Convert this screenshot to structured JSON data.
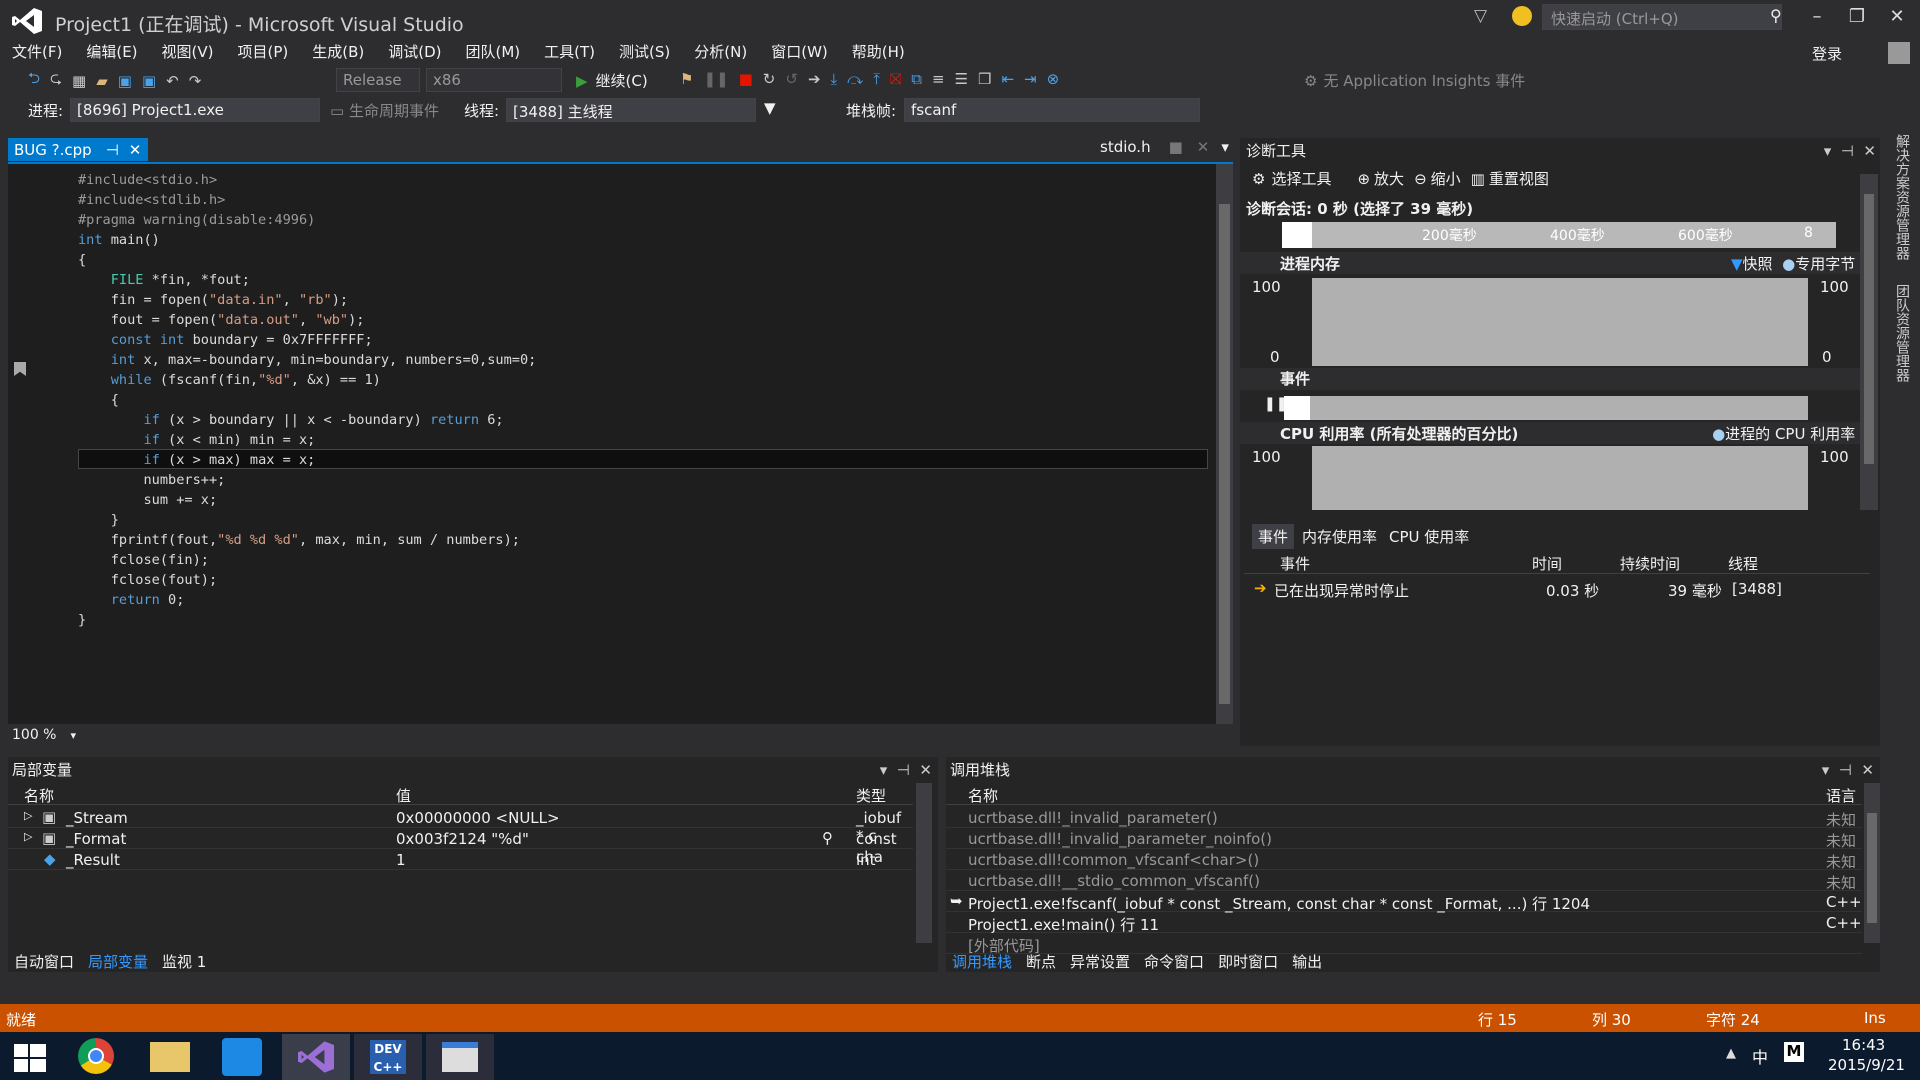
{
  "window": {
    "title": "Project1 (正在调试) - Microsoft Visual Studio",
    "quick_launch_placeholder": "快速启动 (Ctrl+Q)",
    "login": "登录"
  },
  "menu": [
    "文件(F)",
    "编辑(E)",
    "视图(V)",
    "项目(P)",
    "生成(B)",
    "调试(D)",
    "团队(M)",
    "工具(T)",
    "测试(S)",
    "分析(N)",
    "窗口(W)",
    "帮助(H)"
  ],
  "toolbar": {
    "config": "Release",
    "platform": "x86",
    "continue": "继续(C)",
    "insights": "无 Application Insights 事件",
    "process_label": "进程:",
    "process_value": "[8696] Project1.exe",
    "lifecycle": "生命周期事件",
    "thread_label": "线程:",
    "thread_value": "[3488] 主线程",
    "stackframe_label": "堆栈帧:",
    "stackframe_value": "fscanf"
  },
  "editor": {
    "active_tab": "BUG ?.cpp",
    "other_tab": "stdio.h",
    "zoom": "100 %",
    "lines": [
      "#include<stdio.h>",
      "#include<stdlib.h>",
      "#pragma warning(disable:4996)",
      "int main()",
      "{",
      "    FILE *fin, *fout;",
      "    fin = fopen(\"data.in\", \"rb\");",
      "    fout = fopen(\"data.out\", \"wb\");",
      "    const int boundary = 0x7FFFFFFF;",
      "    int x, max=-boundary, min=boundary, numbers=0,sum=0;",
      "    while (fscanf(fin,\"%d\", &x) == 1)",
      "    {",
      "        if (x > boundary || x < -boundary) return 6;",
      "        if (x < min) min = x;",
      "        if (x > max) max = x;",
      "        numbers++;",
      "        sum += x;",
      "    }",
      "    fprintf(fout,\"%d %d %d\", max, min, sum / numbers);",
      "    fclose(fin);",
      "    fclose(fout);",
      "    return 0;",
      "}"
    ]
  },
  "diag": {
    "title": "诊断工具",
    "select_tools": "选择工具",
    "zoom_in": "放大",
    "zoom_out": "缩小",
    "reset_view": "重置视图",
    "session": "诊断会话: 0 秒 (选择了 39 毫秒)",
    "ticks": [
      "200毫秒",
      "400毫秒",
      "600毫秒",
      "8"
    ],
    "memory_title": "进程内存",
    "snapshot": "快照",
    "private_bytes": "专用字节",
    "mem_max": "100",
    "mem_min": "0",
    "events_title": "事件",
    "cpu_title": "CPU 利用率 (所有处理器的百分比)",
    "cpu_legend": "进程的 CPU 利用率",
    "cpu_max": "100",
    "tabs": [
      "事件",
      "内存使用率",
      "CPU 使用率"
    ],
    "cols": [
      "事件",
      "时间",
      "持续时间",
      "线程"
    ],
    "event_row": {
      "name": "已在出现异常时停止",
      "time": "0.03 秒",
      "duration": "39 毫秒",
      "thread": "[3488]"
    }
  },
  "locals": {
    "title": "局部变量",
    "cols": [
      "名称",
      "值",
      "类型"
    ],
    "rows": [
      {
        "name": "_Stream",
        "value": "0x00000000 <NULL>",
        "type": "_iobuf * c"
      },
      {
        "name": "_Format",
        "value": "0x003f2124 \"%d\"",
        "type": "const cha"
      },
      {
        "name": "_Result",
        "value": "1",
        "type": "int"
      }
    ],
    "tabs": [
      "自动窗口",
      "局部变量",
      "监视 1"
    ]
  },
  "callstack": {
    "title": "调用堆栈",
    "cols": [
      "名称",
      "语言"
    ],
    "rows": [
      {
        "name": "ucrtbase.dll!_invalid_parameter()",
        "lang": "未知"
      },
      {
        "name": "ucrtbase.dll!_invalid_parameter_noinfo()",
        "lang": "未知"
      },
      {
        "name": "ucrtbase.dll!common_vfscanf<char>()",
        "lang": "未知"
      },
      {
        "name": "ucrtbase.dll!__stdio_common_vfscanf()",
        "lang": "未知"
      },
      {
        "name": "Project1.exe!fscanf(_iobuf * const _Stream, const char * const _Format, ...) 行 1204",
        "lang": "C++"
      },
      {
        "name": "Project1.exe!main() 行 11",
        "lang": "C++"
      },
      {
        "name": "[外部代码]",
        "lang": ""
      }
    ],
    "tabs": [
      "调用堆栈",
      "断点",
      "异常设置",
      "命令窗口",
      "即时窗口",
      "输出"
    ]
  },
  "status": {
    "ready": "就绪",
    "line": "行 15",
    "col": "列 30",
    "char": "字符 24",
    "ins": "Ins"
  },
  "taskbar": {
    "ime": "中",
    "time": "16:43",
    "date": "2015/9/21"
  }
}
